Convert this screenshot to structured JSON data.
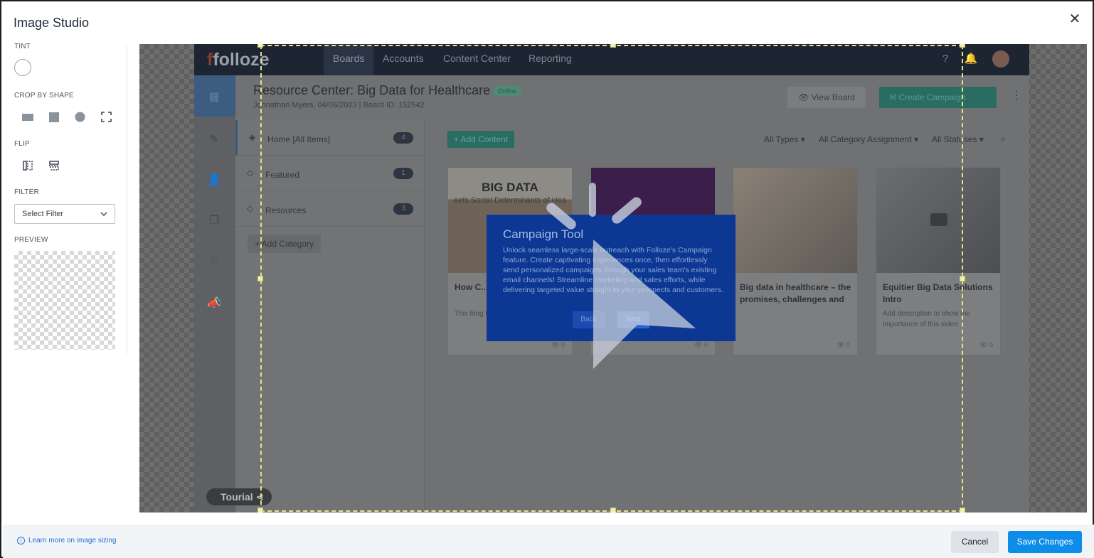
{
  "modal": {
    "title": "Image Studio",
    "close_icon": "close-icon"
  },
  "sidebar": {
    "tint_label": "TINT",
    "crop_label": "CROP BY SHAPE",
    "crop_shapes": [
      "rectangle-wide",
      "square",
      "circle",
      "freeform"
    ],
    "flip_label": "FLIP",
    "flip_options": [
      "flip-horizontal",
      "flip-vertical"
    ],
    "filter_label": "FILTER",
    "filter_selected": "Select Filter",
    "preview_label": "PREVIEW"
  },
  "screenshot": {
    "logo": "folloze",
    "nav": [
      "Boards",
      "Accounts",
      "Content Center",
      "Reporting"
    ],
    "board_title": "Resource Center: Big Data for Healthcare",
    "status": "Online",
    "board_sub": "Johnathan Myers, 04/06/2023 | Board ID: 152542",
    "view_board": "View Board",
    "create_campaign": "Create Campaign",
    "categories": [
      {
        "label": "Home [All Items]",
        "count": "4"
      },
      {
        "label": "Featured",
        "count": "1"
      },
      {
        "label": "Resources",
        "count": "3"
      }
    ],
    "add_category": "+ Add Category",
    "add_content": "+ Add Content",
    "filters": [
      "All Types",
      "All Category Assignment",
      "All Statuses"
    ],
    "cards": [
      {
        "title": "How C... Address...",
        "desc": "This blog i... the directo... Biomed...",
        "img_title": "BIG DATA",
        "img_sub": "eets Social Determinants of Hea"
      },
      {
        "title": "",
        "desc": ""
      },
      {
        "title": "Big data in healthcare – the promises, challenges and",
        "desc": ""
      },
      {
        "title": "Equitier Big Data Solutions Intro",
        "desc": "Add description to show the importance of this video"
      }
    ],
    "views": "0",
    "tourial_badge": "Tourial"
  },
  "popup": {
    "title": "Campaign Tool",
    "body": "Unlock seamless large-scale outreach with Folloze's Campaign feature. Create captivating experiences once, then effortlessly send personalized campaigns through your sales team's existing email channels! Streamline marketing and sales efforts, while delivering targeted value straight to your prospects and customers.",
    "back": "Back",
    "next": "Next"
  },
  "footer": {
    "learn_more": "Learn more on image sizing",
    "cancel": "Cancel",
    "save": "Save Changes"
  },
  "colors": {
    "primary": "#0d8de8",
    "crop_frame": "#e8e08a",
    "popup_bg": "#0c3894"
  }
}
